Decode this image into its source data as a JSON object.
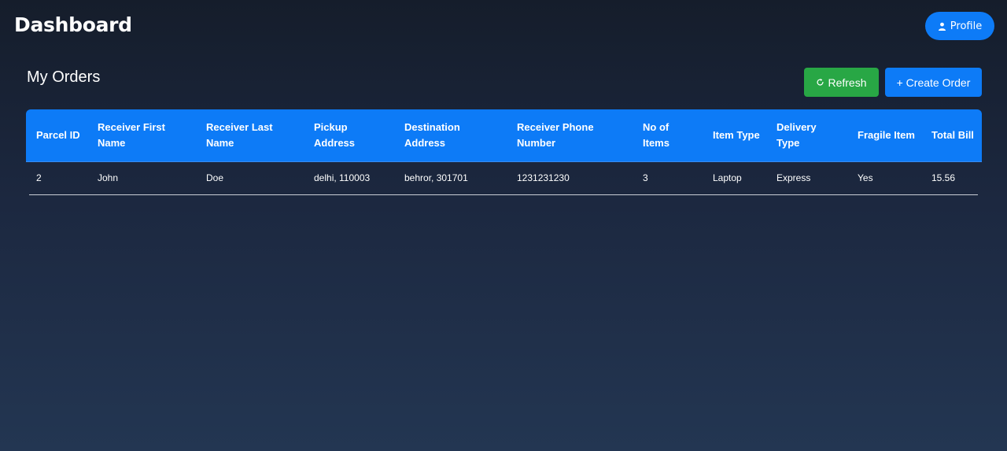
{
  "header": {
    "title": "Dashboard",
    "profile_label": "Profile",
    "profile_icon": "user-icon"
  },
  "main": {
    "section_title": "My Orders",
    "refresh_label": "Refresh",
    "refresh_icon": "refresh-icon",
    "create_label": "+ Create Order"
  },
  "table": {
    "columns": [
      "Parcel ID",
      "Receiver First Name",
      "Receiver Last Name",
      "Pickup Address",
      "Destination Address",
      "Receiver Phone Number",
      "No of Items",
      "Item Type",
      "Delivery Type",
      "Fragile Item",
      "Total Bill"
    ],
    "rows": [
      [
        "2",
        "John",
        "Doe",
        "delhi, 110003",
        "behror, 301701",
        "1231231230",
        "3",
        "Laptop",
        "Express",
        "Yes",
        "15.56"
      ]
    ]
  },
  "colors": {
    "primary": "#0d7bf7",
    "success": "#28a745",
    "background_top": "#151d2b",
    "background_bottom": "#233652"
  }
}
